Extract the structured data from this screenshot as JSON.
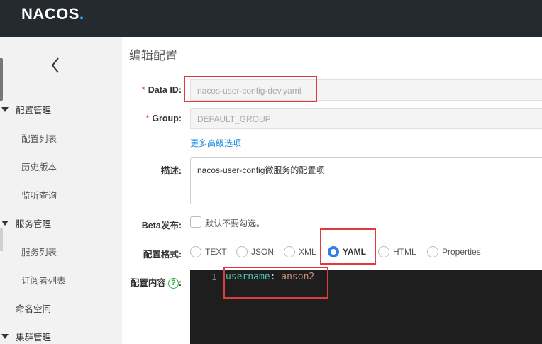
{
  "app": {
    "logo_main": "NACOS",
    "logo_dot": "."
  },
  "sidebar": {
    "groups": [
      {
        "label": "配置管理",
        "items": [
          "配置列表",
          "历史版本",
          "监听查询"
        ]
      },
      {
        "label": "服务管理",
        "items": [
          "服务列表",
          "订阅者列表"
        ]
      }
    ],
    "plain_item": "命名空间",
    "last_group": "集群管理"
  },
  "main": {
    "title": "编辑配置",
    "data_id": {
      "label": "Data ID:",
      "required": "*",
      "value": "nacos-user-config-dev.yaml"
    },
    "group": {
      "label": "Group:",
      "required": "*",
      "value": "DEFAULT_GROUP"
    },
    "advanced_link": "更多高级选项",
    "description": {
      "label": "描述:",
      "value": "nacos-user-config微服务的配置项"
    },
    "beta": {
      "label": "Beta发布:",
      "checkbox_label": "默认不要勾选。"
    },
    "format": {
      "label": "配置格式:",
      "options": [
        "TEXT",
        "JSON",
        "XML",
        "YAML",
        "HTML",
        "Properties"
      ],
      "selected": "YAML"
    },
    "content": {
      "label": "配置内容",
      "help": "?",
      "colon": ":",
      "line_number": "1",
      "code_key": "username",
      "code_sep": ": ",
      "code_value": "anson2"
    }
  },
  "colors": {
    "accent": "#2f7fe8",
    "highlight": "#e0393e",
    "topbar": "#252a2f"
  }
}
